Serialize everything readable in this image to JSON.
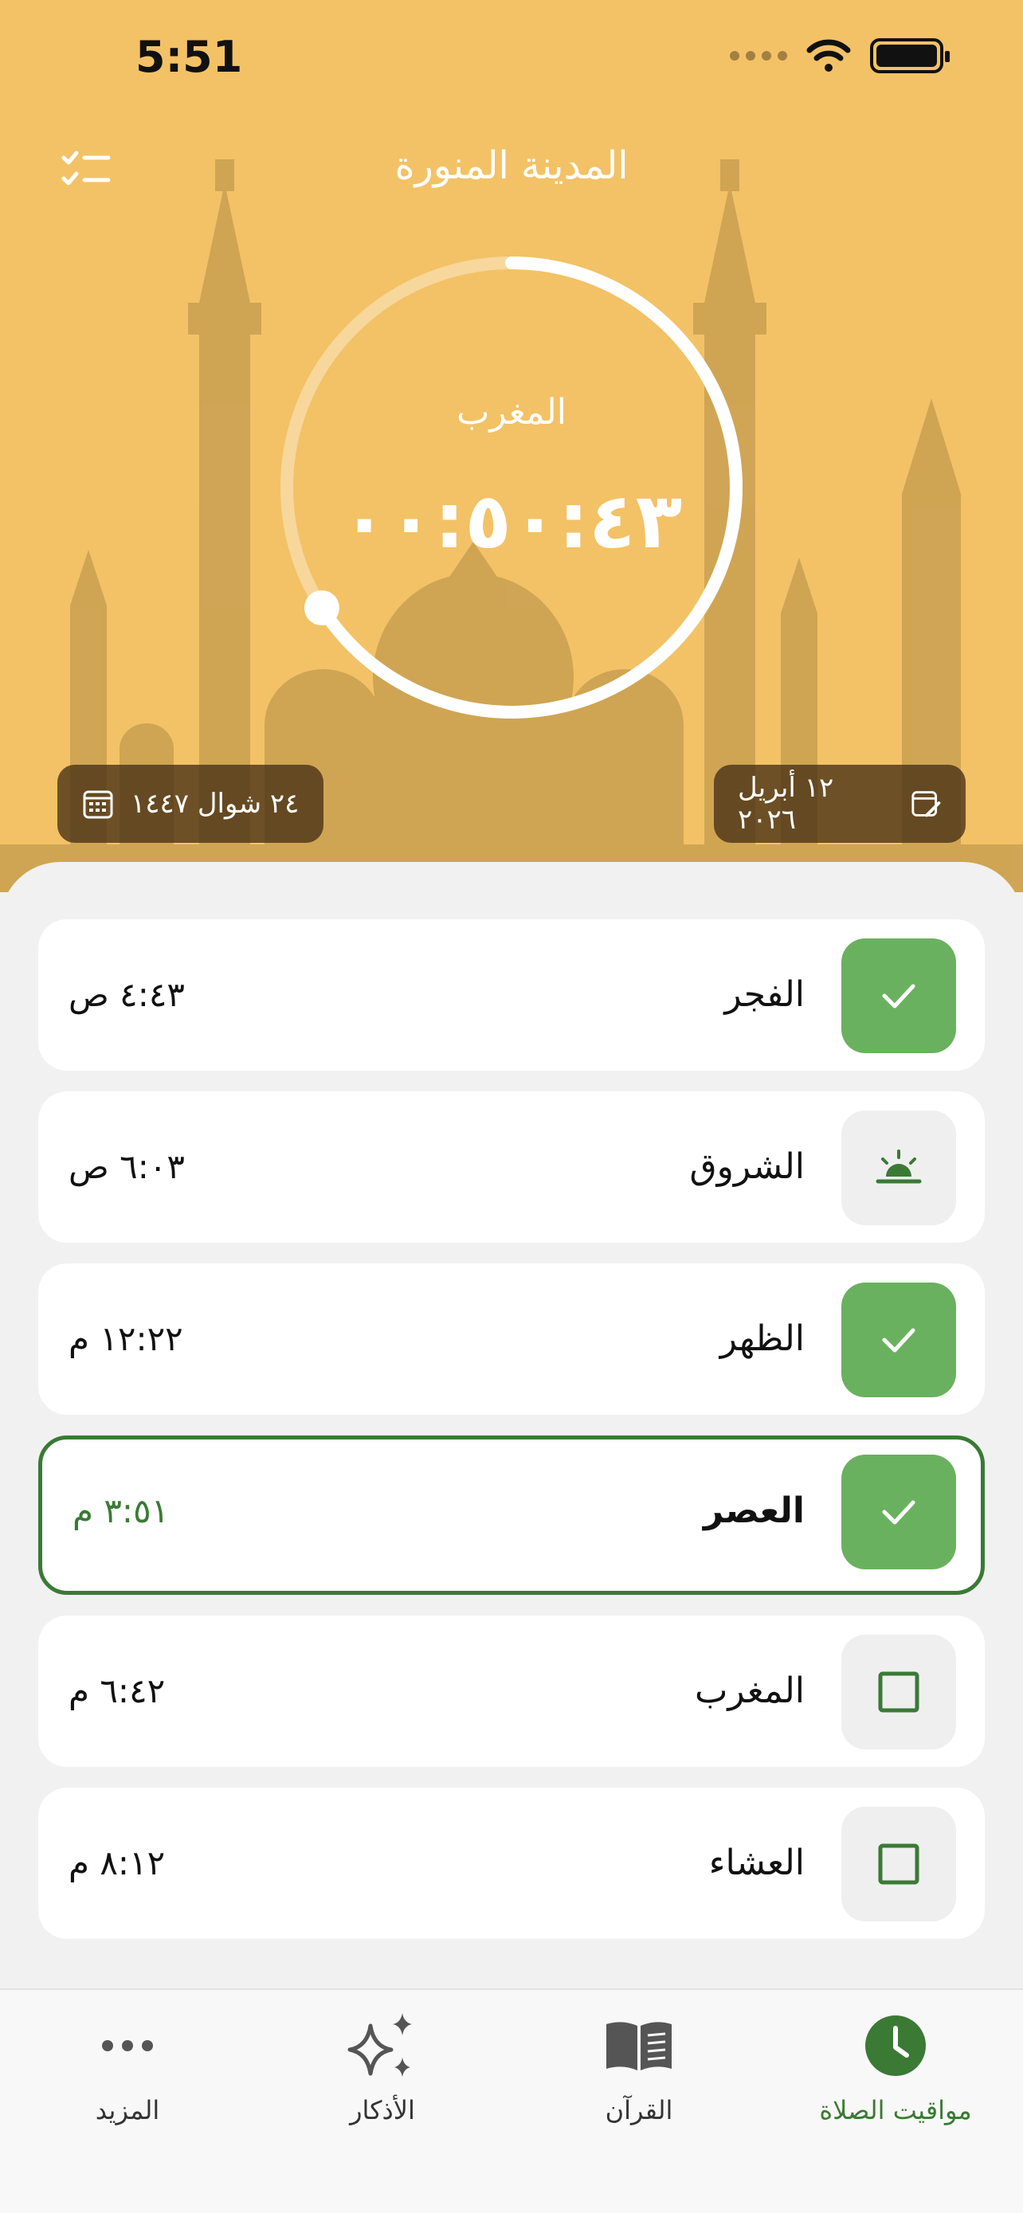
{
  "status_bar": {
    "time": "5:51"
  },
  "header": {
    "city": "المدينة المنورة",
    "next_prayer": "المغرب",
    "countdown": "٠٠:٥٠:٤٣",
    "progress": 0.66,
    "hijri_date": "٢٤ شوال ١٤٤٧",
    "gregorian_date": "١٢ أبريل ٢٠٢٦"
  },
  "prayers": [
    {
      "name": "الفجر",
      "time": "٤:٤٣ ص",
      "state": "done"
    },
    {
      "name": "الشروق",
      "time": "٦:٠٣ ص",
      "state": "sunrise"
    },
    {
      "name": "الظهر",
      "time": "١٢:٢٢ م",
      "state": "done"
    },
    {
      "name": "العصر",
      "time": "٣:٥١ م",
      "state": "done",
      "active": true
    },
    {
      "name": "المغرب",
      "time": "٦:٤٢ م",
      "state": "pending"
    },
    {
      "name": "العشاء",
      "time": "٨:١٢ م",
      "state": "pending"
    }
  ],
  "tabs": {
    "more": "المزيد",
    "azkar": "الأذكار",
    "quran": "القرآن",
    "prayer_times": "مواقيت الصلاة"
  },
  "colors": {
    "header_bg": "#f3c266",
    "accent_green": "#3a7a35",
    "check_green": "#6ab15f"
  }
}
